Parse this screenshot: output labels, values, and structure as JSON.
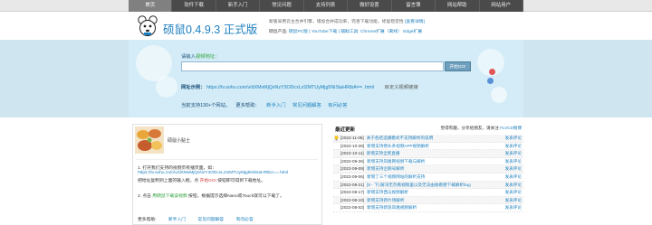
{
  "nav": {
    "items": [
      "首页",
      "软件下载",
      "新手入门",
      "常见问题",
      "支持列表",
      "微好设置",
      "留言簿",
      "网站帮助",
      "网站用户"
    ],
    "active_index": 0
  },
  "header": {
    "brand": "硕鼠0.4.9.3 正式版",
    "line1_text": "新版采用云主合并引擎，增加合并成功率，完善下载功能，修复稳定性",
    "line1_link": "[查看详情]",
    "line2_label": "硕鼠产品:",
    "line2_items": "硕鼠PC版 | YouTube下载 | 辅助工具: Chrome扩展（离线） Edge扩展"
  },
  "banner": {
    "input_label": "请输入",
    "input_hint": "视频地址：",
    "input_value": "",
    "input_placeholder": "",
    "go_button": "开始GO!",
    "example_label": "网址示例：",
    "example_url": "https://tv.sohu.com/v/dXMvMjQxNzY3ODcxLzI2MTUyMjg5NiStaHRtbA== .html",
    "example_tail": "目定义视频链接",
    "support_prefix": "当前支持130+个网站，",
    "support_more": "更多帮助：",
    "support_links": [
      "新手入门",
      "常见问题解答",
      "有问必答"
    ]
  },
  "left_panel": {
    "title": "硕鼠小贴士",
    "step1_line1": "1. 打开我们支持的视频页有播页面，如：",
    "step1_line2": "https://tv.sohu.com/v/dXMvMjQxNzY3ODcxLzI2MTUyMjg5NiStaHRtbA==.html",
    "step1_line3_a": "把地址复制到上面的输入框，点",
    "step1_line3_b": "开始GO!",
    "step1_line3_c": "按钮即可得到下载地址。",
    "step2_a": "2. 点击",
    "step2_b": "用硕鼠下载该视频",
    "step2_c": "按钮，根据提示选择Nano或Touch就可以下载了。",
    "footer_label": "更多帮助:",
    "footer_links": [
      "新手入门",
      "常见问题解答",
      "有问必答"
    ]
  },
  "right_panel": {
    "title": "最近更新",
    "share_text": "觉得有趣，分享给朋友，请关注",
    "share_link": "FLVCD微博",
    "updates": [
      {
        "date": "[2022-11-05]",
        "text": "关于各结选播模式不支持解析的说明",
        "action": "发表评论"
      },
      {
        "date": "[2022-10-28]",
        "text": "新增支持扬头条视频APP视频解析",
        "action": "发表评论"
      },
      {
        "date": "[2022-10-11]",
        "text": "新增支持全民直播",
        "action": "发表评论"
      },
      {
        "date": "[2022-09-26]",
        "text": "新增支持凤凰网视频下载与解析",
        "action": "发表评论"
      },
      {
        "date": "[2022-09-09]",
        "text": "新增支持企鹅号解析",
        "action": "发表评论"
      },
      {
        "date": "[2022-09-06]",
        "text": "新增了三个视频网站的解析支持",
        "action": "发表评论"
      },
      {
        "date": "[2022-08-21]",
        "text": "[8 - 下] 解决无奈看视频里以及无法由收看便下载解析bug",
        "action": "发表评论"
      },
      {
        "date": "[2022-08-17]",
        "text": "新增支持西瓜视频解析",
        "action": "发表评论"
      },
      {
        "date": "[2022-08-10]",
        "text": "新增支持新片场解析",
        "action": "发表评论"
      },
      {
        "date": "[2022-08-02]",
        "text": "新增支持新浪凤凰视频解析",
        "action": "发表评论"
      }
    ]
  },
  "colors": {
    "nav_bg": "#4a4a4a",
    "nav_active": "#808080",
    "banner_bg": "#d3ecf7",
    "link": "#1c7fbf",
    "accent_green": "#2ea23b"
  }
}
